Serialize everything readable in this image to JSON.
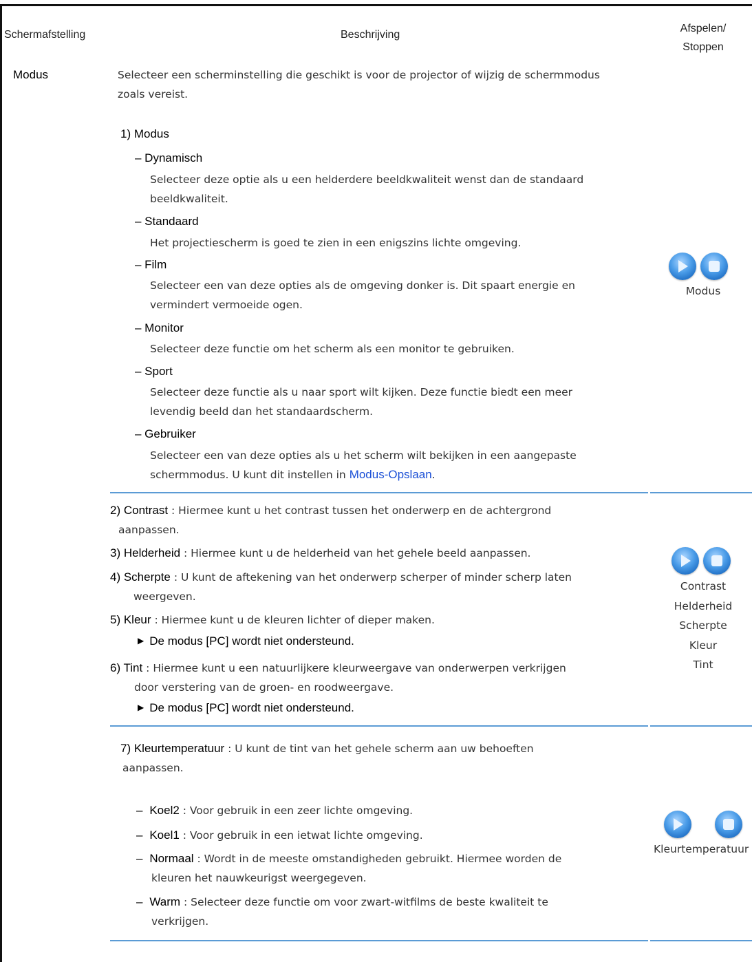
{
  "header": {
    "col1": "Schermafstelling",
    "col2": "Beschrijving",
    "col3_line1": "Afspelen/",
    "col3_line2": "Stoppen"
  },
  "row_label": "Modus",
  "intro_line1": "Selecteer een scherminstelling die geschikt is voor de projector of wijzig de schermmodus",
  "intro_line2": "zoals vereist.",
  "section1_heading": "1) Modus",
  "modes": [
    {
      "title": "– Dynamisch",
      "line1": "Selecteer deze optie als u een helderdere beeldkwaliteit wenst dan de standaard",
      "line2": "beeldkwaliteit."
    },
    {
      "title": "– Standaard",
      "line1": "Het projectiescherm is goed te zien in een enigszins lichte omgeving.",
      "line2": ""
    },
    {
      "title": "– Film",
      "line1": "Selecteer een van deze opties als de omgeving donker is. Dit spaart energie en",
      "line2": "vermindert vermoeide ogen."
    },
    {
      "title": "– Monitor",
      "line1": "Selecteer deze functie om het scherm als een monitor te gebruiken.",
      "line2": ""
    },
    {
      "title": "– Sport",
      "line1": "Selecteer deze functie als u naar sport wilt kijken. Deze functie biedt een meer",
      "line2": "levendig beeld dan het standaardscherm."
    },
    {
      "title": "– Gebruiker",
      "line1": "Selecteer een van deze opties als u het scherm wilt bekijken in een aangepaste",
      "line2_pre": "schermmodus. U kunt dit instellen in ",
      "line2_link": "Modus-Opslaan",
      "line2_post": "."
    }
  ],
  "group1_button_label": "Modus",
  "section2": [
    {
      "key": "2) Contrast",
      "text1": " : Hiermee kunt u het contrast tussen het onderwerp en de achtergrond",
      "text2": "aanpassen."
    },
    {
      "key": "3) Helderheid",
      "text1": " : Hiermee kunt u de helderheid van het gehele beeld aanpassen.",
      "text2": ""
    },
    {
      "key": "4) Scherpte",
      "text1": " : U kunt de aftekening van het onderwerp scherper of minder scherp laten",
      "text2": "weergeven."
    },
    {
      "key": "5) Kleur",
      "text1": " : Hiermee kunt u de kleuren lichter of dieper maken.",
      "text2": ""
    },
    {
      "key": "6) Tint",
      "text1": " : Hiermee kunt u een natuurlijkere kleurweergave van onderwerpen verkrijgen",
      "text2": "door verstering van de groen- en roodweergave."
    }
  ],
  "note_text": "De modus [PC] wordt niet ondersteund.",
  "group2_labels": [
    "Contrast",
    "Helderheid",
    "Scherpte",
    "Kleur",
    "Tint"
  ],
  "section3_key": "7) Kleurtemperatuur",
  "section3_text1": " : U kunt de tint van het gehele scherm aan uw behoeften",
  "section3_text2": "aanpassen.",
  "temps": [
    {
      "key": "Koel2",
      "text1": " : Voor gebruik in een zeer lichte omgeving.",
      "text2": ""
    },
    {
      "key": "Koel1",
      "text1": " : Voor gebruik in een ietwat lichte omgeving.",
      "text2": ""
    },
    {
      "key": "Normaal",
      "text1": " : Wordt in de meeste omstandigheden gebruikt. Hiermee worden de",
      "text2": "kleuren het nauwkeurigst weergegeven."
    },
    {
      "key": "Warm",
      "text1": " : Selecteer deze functie om voor zwart-witfilms de beste kwaliteit te",
      "text2": "verkrijgen."
    }
  ],
  "temp_dash": "–",
  "group3_button_label": "Kleurtemperatuur",
  "colors": {
    "separator": "#5b9bd5",
    "link": "#1a4fd6",
    "button": "#4a9ce8"
  },
  "icons": [
    "play-icon",
    "stop-icon"
  ]
}
